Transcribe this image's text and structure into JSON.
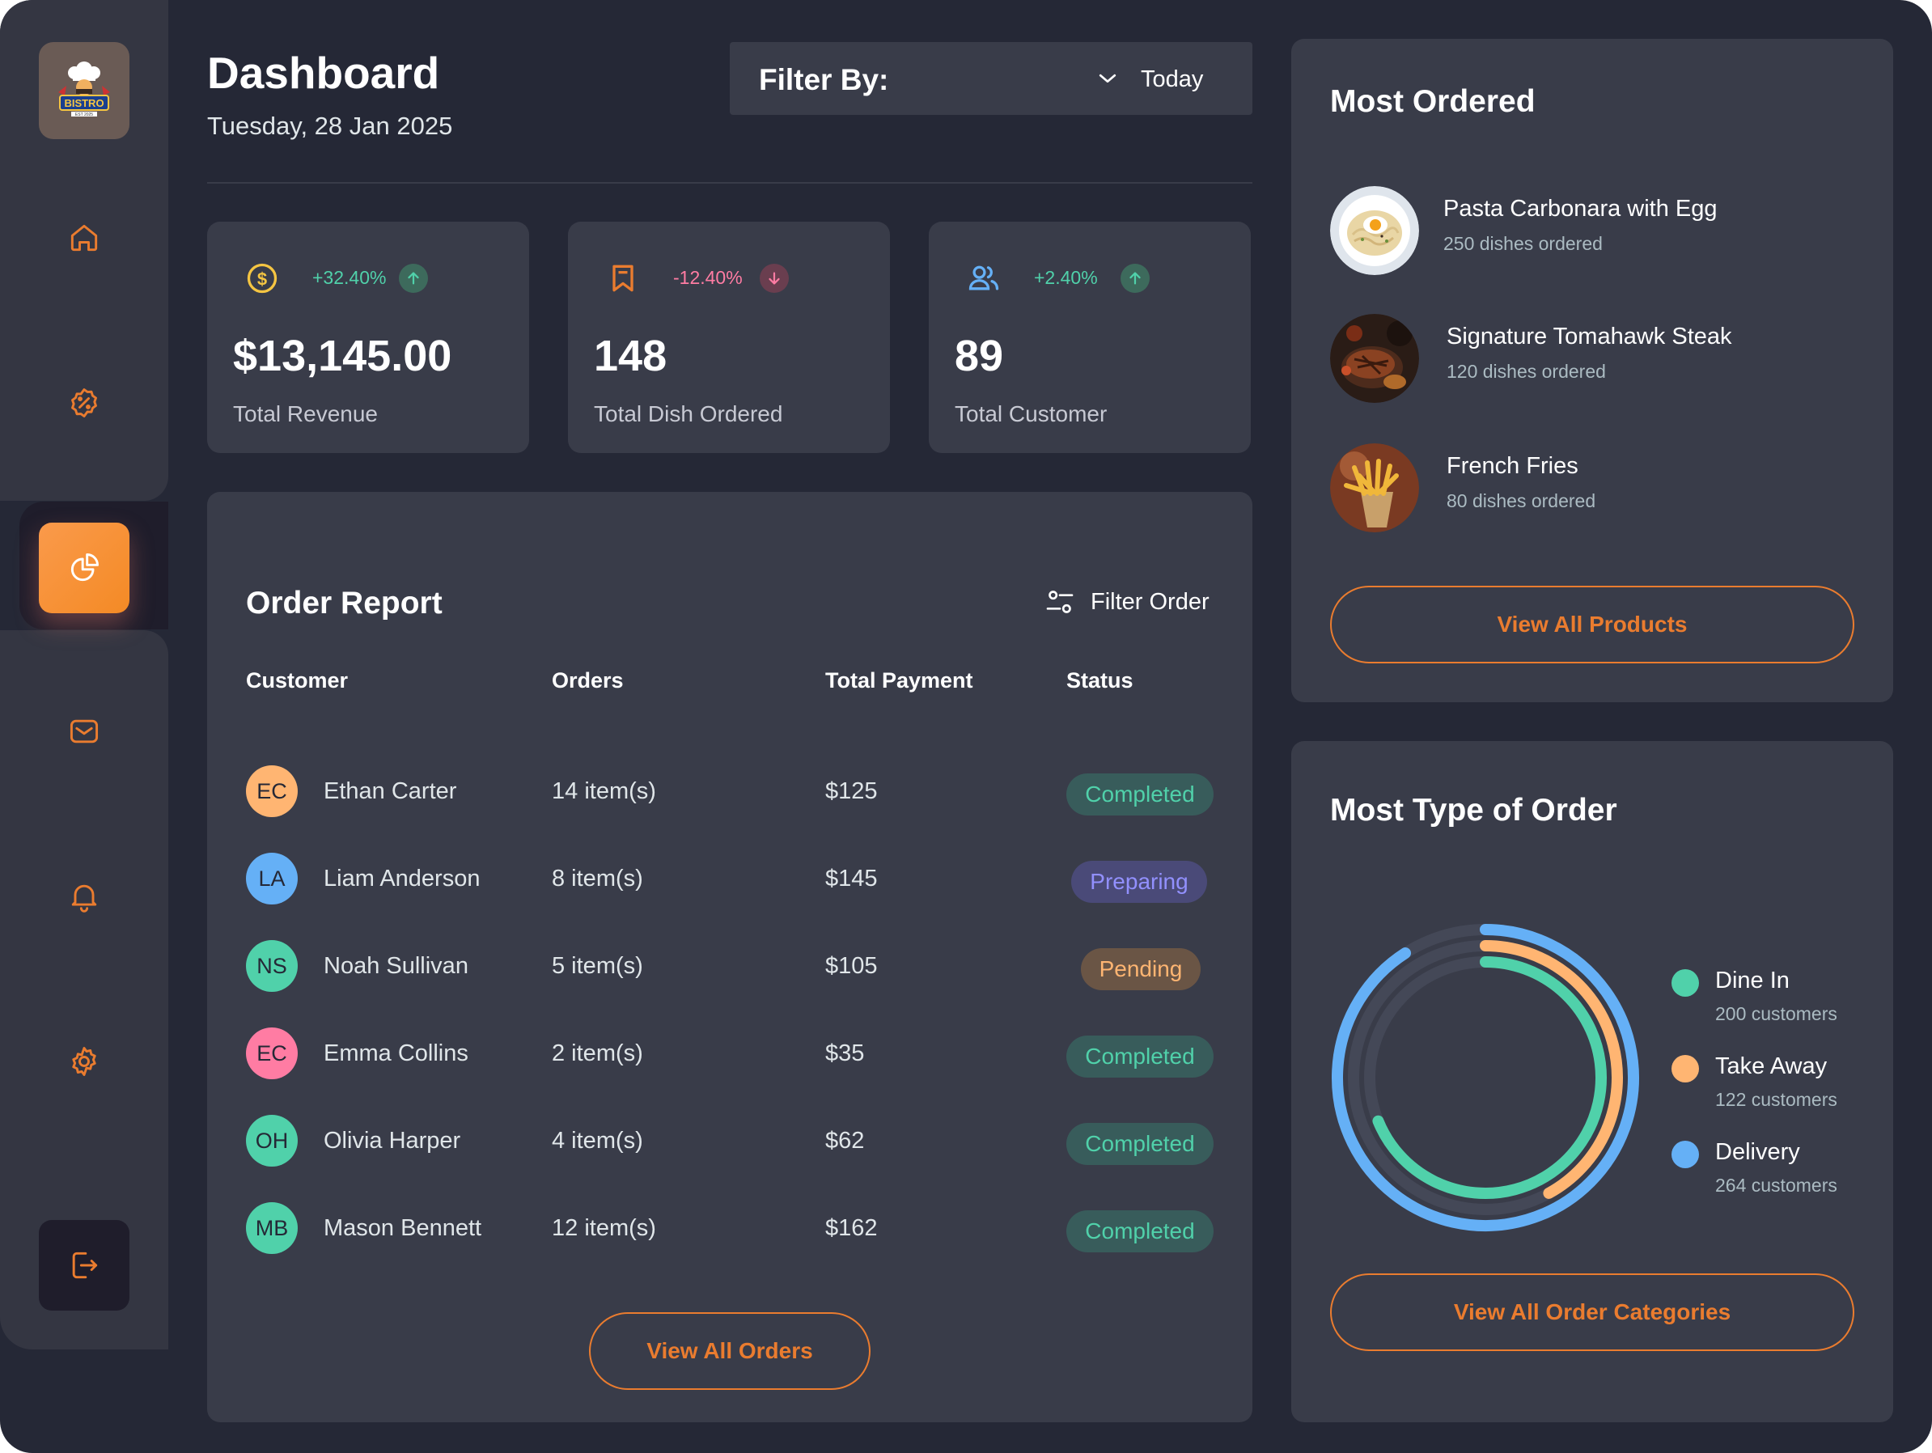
{
  "brand": {
    "logo_text": "BISTRO",
    "logo_sub": "EST 2025"
  },
  "sidebar": {
    "items": [
      {
        "name": "home",
        "icon": "home-icon"
      },
      {
        "name": "discount",
        "icon": "discount-badge-icon"
      },
      {
        "name": "dashboard",
        "icon": "pie-chart-icon",
        "active": true
      },
      {
        "name": "messages",
        "icon": "mail-icon"
      },
      {
        "name": "notifications",
        "icon": "bell-icon"
      },
      {
        "name": "settings",
        "icon": "gear-icon"
      },
      {
        "name": "logout",
        "icon": "logout-icon"
      }
    ]
  },
  "header": {
    "title": "Dashboard",
    "date": "Tuesday, 28 Jan 2025",
    "filter_label": "Filter By:",
    "filter_value": "Today"
  },
  "stats": [
    {
      "icon": "dollar-coin-icon",
      "change": "+32.40%",
      "direction": "up",
      "value": "$13,145.00",
      "label": "Total Revenue",
      "change_color": "#50d1aa"
    },
    {
      "icon": "bookmark-icon",
      "change": "-12.40%",
      "direction": "down",
      "value": "148",
      "label": "Total Dish Ordered",
      "change_color": "#ff7ca3"
    },
    {
      "icon": "users-icon",
      "change": "+2.40%",
      "direction": "up",
      "value": "89",
      "label": "Total Customer",
      "change_color": "#50d1aa"
    }
  ],
  "report": {
    "title": "Order Report",
    "filter_label": "Filter Order",
    "columns": [
      "Customer",
      "Orders",
      "Total Payment",
      "Status"
    ],
    "rows": [
      {
        "initials": "EC",
        "name": "Ethan Carter",
        "orders": "14 item(s)",
        "payment": "$125",
        "status": "Completed",
        "avatar_color": "#ffb572"
      },
      {
        "initials": "LA",
        "name": "Liam Anderson",
        "orders": "8 item(s)",
        "payment": "$145",
        "status": "Preparing",
        "avatar_color": "#65b0f6"
      },
      {
        "initials": "NS",
        "name": "Noah Sullivan",
        "orders": "5 item(s)",
        "payment": "$105",
        "status": "Pending",
        "avatar_color": "#50d1aa"
      },
      {
        "initials": "EC",
        "name": "Emma Collins",
        "orders": "2 item(s)",
        "payment": "$35",
        "status": "Completed",
        "avatar_color": "#ff7ca3"
      },
      {
        "initials": "OH",
        "name": "Olivia Harper",
        "orders": "4 item(s)",
        "payment": "$62",
        "status": "Completed",
        "avatar_color": "#50d1aa"
      },
      {
        "initials": "MB",
        "name": "Mason Bennett",
        "orders": "12 item(s)",
        "payment": "$162",
        "status": "Completed",
        "avatar_color": "#50d1aa"
      }
    ],
    "view_all_label": "View All Orders"
  },
  "most_ordered": {
    "title": "Most Ordered",
    "items": [
      {
        "name": "Pasta Carbonara with Egg",
        "sub": "250 dishes ordered"
      },
      {
        "name": "Signature Tomahawk Steak",
        "sub": "120 dishes ordered"
      },
      {
        "name": "French Fries",
        "sub": "80 dishes ordered"
      }
    ],
    "view_all_label": "View All Products"
  },
  "order_types": {
    "title": "Most Type of Order",
    "view_all_label": "View All Order Categories"
  },
  "chart_data": {
    "type": "radial-bar",
    "series": [
      {
        "name": "Dine In",
        "value": 200,
        "label": "200 customers",
        "color": "#50d1aa"
      },
      {
        "name": "Take Away",
        "value": 122,
        "label": "122 customers",
        "color": "#ffb572"
      },
      {
        "name": "Delivery",
        "value": 264,
        "label": "264 customers",
        "color": "#65b0f6"
      }
    ]
  },
  "colors": {
    "accent": "#ea7c2f",
    "background": "#252836",
    "card": "#393c49",
    "sidebar": "#343642"
  }
}
